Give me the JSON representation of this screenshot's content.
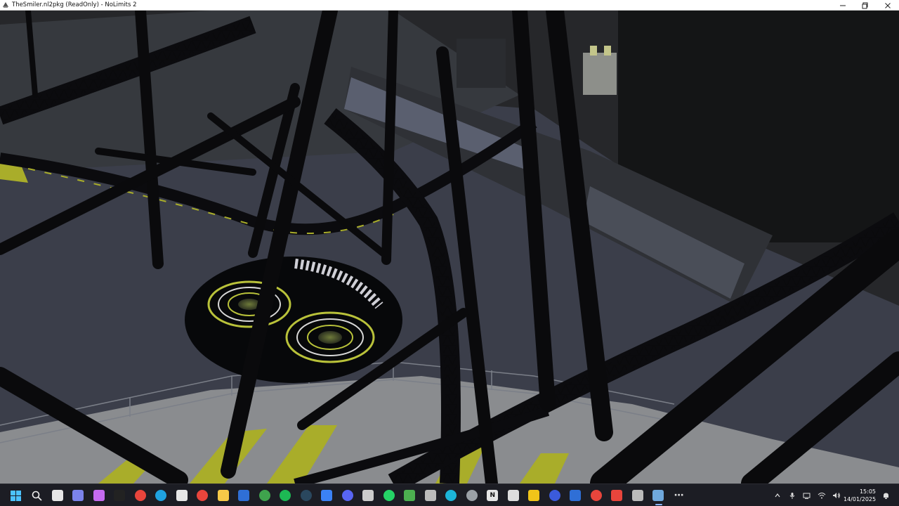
{
  "window": {
    "title": "TheSmiler.nl2pkg (ReadOnly) - NoLimits 2",
    "icon": "nolimits-app-icon",
    "controls": [
      "minimize-icon",
      "maximize-icon",
      "close-icon"
    ]
  },
  "taskbar": {
    "icons": [
      {
        "name": "start-icon",
        "color": "#4cc2ff",
        "glyph": ""
      },
      {
        "name": "search-icon",
        "color": "",
        "glyph": ""
      },
      {
        "name": "task-view-icon",
        "color": "#e6e6e6",
        "glyph": ""
      },
      {
        "name": "teams-chat-icon",
        "color": "#7b83eb",
        "glyph": ""
      },
      {
        "name": "copilot-icon",
        "color": "#c56bf0",
        "glyph": ""
      },
      {
        "name": "nolimits-editor-icon",
        "color": "#222222",
        "glyph": ""
      },
      {
        "name": "red-app-icon",
        "color": "#e8453c",
        "glyph": ""
      },
      {
        "name": "edge-icon",
        "color": "#1fa2e0",
        "glyph": ""
      },
      {
        "name": "store-icon",
        "color": "#e6e6e6",
        "glyph": ""
      },
      {
        "name": "chrome-icon",
        "color": "#e8453c",
        "glyph": ""
      },
      {
        "name": "file-explorer-icon",
        "color": "#f7c948",
        "glyph": ""
      },
      {
        "name": "booking-app-icon",
        "color": "#2f6fd6",
        "glyph": ""
      },
      {
        "name": "xbox-icon",
        "color": "#3fa34d",
        "glyph": ""
      },
      {
        "name": "spotify-icon",
        "color": "#1db954",
        "glyph": ""
      },
      {
        "name": "steam-icon",
        "color": "#2a475e",
        "glyph": ""
      },
      {
        "name": "blue-app-icon",
        "color": "#3b82f6",
        "glyph": ""
      },
      {
        "name": "discord-icon",
        "color": "#5865f2",
        "glyph": ""
      },
      {
        "name": "tool-app-icon",
        "color": "#cccccc",
        "glyph": ""
      },
      {
        "name": "whatsapp-icon",
        "color": "#25d366",
        "glyph": ""
      },
      {
        "name": "minecraft-icon",
        "color": "#4caf50",
        "glyph": ""
      },
      {
        "name": "media-app-icon",
        "color": "#bbbbbb",
        "glyph": ""
      },
      {
        "name": "cyan-app-icon",
        "color": "#1cb5d8",
        "glyph": ""
      },
      {
        "name": "settings-icon",
        "color": "#9aa0a6",
        "glyph": ""
      },
      {
        "name": "nolimits-icon",
        "color": "#e6e6e6",
        "glyph": "N"
      },
      {
        "name": "audio-mixer-icon",
        "color": "#dddddd",
        "glyph": ""
      },
      {
        "name": "star-app-icon",
        "color": "#f0c419",
        "glyph": ""
      },
      {
        "name": "profile-app-icon",
        "color": "#3b5bdb",
        "glyph": ""
      },
      {
        "name": "docs-icon",
        "color": "#2f6fd6",
        "glyph": ""
      },
      {
        "name": "opera-icon",
        "color": "#e8453c",
        "glyph": ""
      },
      {
        "name": "youtube-app-icon",
        "color": "#e8453c",
        "glyph": ""
      },
      {
        "name": "keyboard-app-icon",
        "color": "#bbbbbb",
        "glyph": ""
      },
      {
        "name": "nolimits-active-icon",
        "color": "#6fa8dc",
        "glyph": ""
      },
      {
        "name": "overflow-icon",
        "color": "",
        "glyph": "⋯"
      }
    ],
    "tray": [
      "chevron-up-icon",
      "microphone-icon",
      "display-icon",
      "wifi-icon",
      "volume-icon"
    ],
    "time": "15:05",
    "date": "14/01/2025",
    "notification": "notification-icon"
  },
  "scene": {
    "sky_color": "#2a2b2d",
    "ground_color": "#3b3e4a",
    "track_color": "#0d0d10",
    "accent_yellow": "#b9c23a"
  }
}
